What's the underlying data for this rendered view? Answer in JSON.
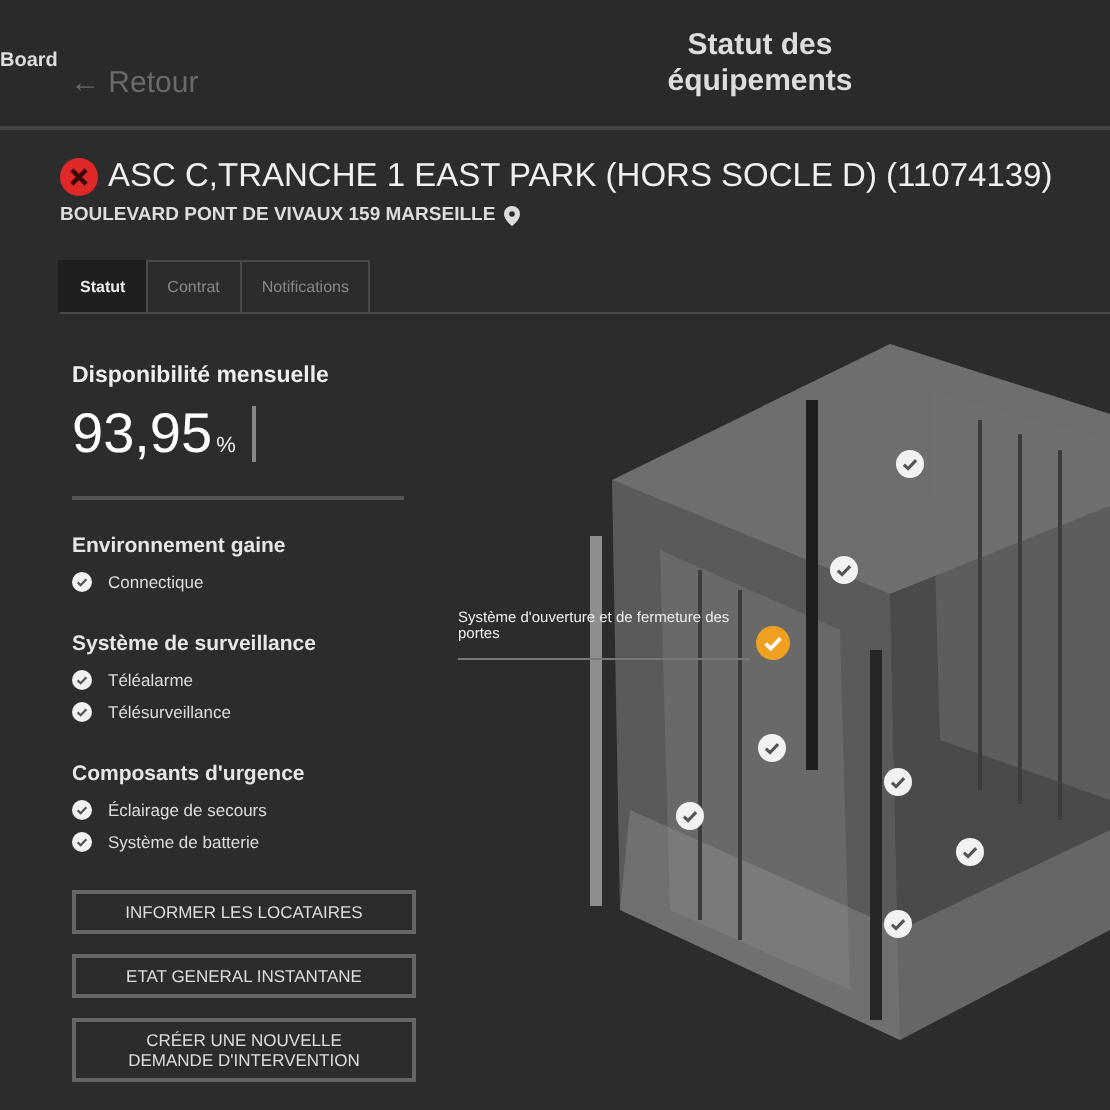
{
  "header": {
    "breadcrumb": "Board",
    "back_link": "← Retour",
    "title": "Statut des équipements"
  },
  "equipment": {
    "in_fault": true,
    "name": "ASC C,TRANCHE 1 EAST PARK (HORS SOCLE D) (11074139)",
    "address": "BOULEVARD PONT DE VIVAUX 159 MARSEILLE"
  },
  "tabs": [
    {
      "label": "Statut",
      "selected": true
    },
    {
      "label": "Contrat",
      "selected": false
    },
    {
      "label": "Notifications",
      "selected": false
    }
  ],
  "availability": {
    "label": "Disponibilité mensuelle",
    "value": "93,95",
    "unit": "%"
  },
  "sections": [
    {
      "title": "Environnement gaine",
      "items": [
        {
          "label": "Connectique",
          "checked": true
        }
      ]
    },
    {
      "title": "Système de surveillance",
      "items": [
        {
          "label": "Téléalarme",
          "checked": true
        },
        {
          "label": "Télésurveillance",
          "checked": true
        }
      ]
    },
    {
      "title": "Composants d'urgence",
      "items": [
        {
          "label": "Éclairage de secours",
          "checked": true
        },
        {
          "label": "Système de batterie",
          "checked": true
        }
      ]
    }
  ],
  "actions": [
    "INFORMER LES LOCATAIRES",
    "ETAT GENERAL INSTANTANE",
    "CRÉER UNE NOUVELLE\nDEMANDE D'INTERVENTION"
  ],
  "diagram": {
    "markers": [
      {
        "warning": false
      },
      {
        "warning": false
      },
      {
        "warning": true,
        "label": "Système d'ouverture et de fermeture des portes"
      },
      {
        "warning": false
      },
      {
        "warning": false
      },
      {
        "warning": false
      },
      {
        "warning": false
      },
      {
        "warning": false
      }
    ]
  }
}
